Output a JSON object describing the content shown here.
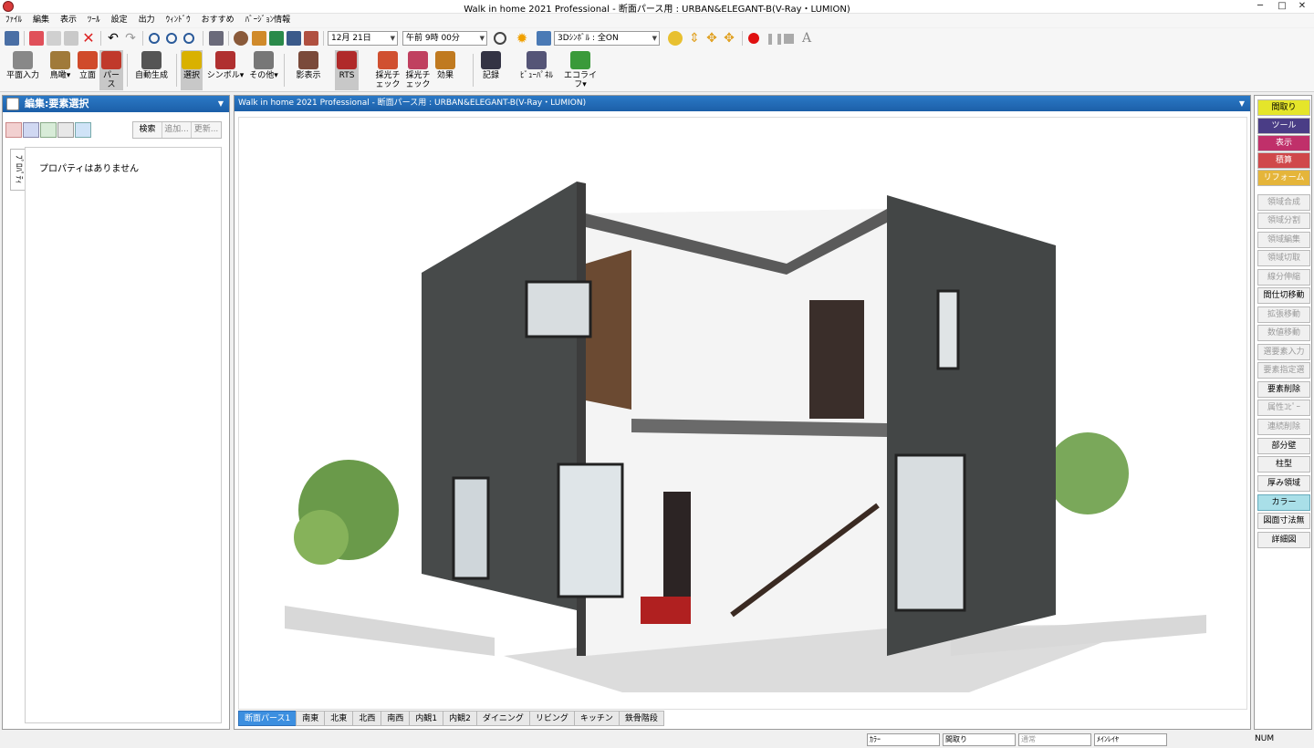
{
  "window": {
    "title": "Walk in home 2021 Professional - 断面パース用 : URBAN&ELEGANT-B(V-Ray・LUMION)",
    "minimize": "─",
    "maximize": "□",
    "close": "✕"
  },
  "menu": [
    "ﾌｧｲﾙ",
    "編集",
    "表示",
    "ﾂｰﾙ",
    "設定",
    "出力",
    "ｳｨﾝﾄﾞｳ",
    "おすすめ",
    "ﾊﾞｰｼﾞｮﾝ情報"
  ],
  "toolbar1": {
    "date": "12月 21日",
    "time": "午前 9時 00分",
    "symbol3d": "3Dｼﾝﾎﾞﾙ : 全ON"
  },
  "toolbar2": [
    {
      "label": "平面入力",
      "color": "#5a5a5a"
    },
    {
      "label": "鳥瞰▾",
      "color": "#9a6a2a"
    },
    {
      "label": "立面",
      "color": "#d04a2a"
    },
    {
      "label": "パース",
      "color": "#c0392b",
      "active": true
    },
    {
      "label": "自動生成",
      "color": "#555"
    },
    {
      "label": "選択",
      "color": "#d9b100",
      "active": true
    },
    {
      "label": "シンボル▾",
      "color": "#b03030"
    },
    {
      "label": "その他▾",
      "color": "#777"
    },
    {
      "label": "影表示",
      "color": "#7a4a3a"
    },
    {
      "label": "RTS",
      "color": "#b02a2a",
      "active": true
    },
    {
      "label": "採光チェック",
      "color": "#d05030"
    },
    {
      "label": "採光チェック",
      "color": "#c04060"
    },
    {
      "label": "効果",
      "color": "#c07a20"
    },
    {
      "label": "記録",
      "color": "#334"
    },
    {
      "label": "ﾋﾞｭｰﾊﾟﾈﾙ",
      "color": "#557"
    },
    {
      "label": "エコライフ▾",
      "color": "#3a9a3a"
    }
  ],
  "leftpanel": {
    "title": "編集:要素選択",
    "search": "検索",
    "add": "追加...",
    "update": "更新...",
    "side_tab": "ﾌﾟﾛﾊﾟﾃｨ",
    "empty": "プロパティはありません"
  },
  "view": {
    "title": "Walk in home 2021 Professional - 断面パース用 : URBAN&ELEGANT-B(V-Ray・LUMION)"
  },
  "tabs": [
    "断面パース1",
    "南東",
    "北東",
    "北西",
    "南西",
    "内観1",
    "内観2",
    "ダイニング",
    "リビング",
    "キッチン",
    "鉄骨階段"
  ],
  "rightpanel": {
    "top": [
      {
        "label": "間取り",
        "color": "#e5e52a",
        "text": "#000"
      },
      {
        "label": "ツール",
        "color": "#4a3d86",
        "text": "#fff"
      },
      {
        "label": "表示",
        "color": "#c0306a",
        "text": "#fff"
      },
      {
        "label": "積算",
        "color": "#d0484a",
        "text": "#fff"
      },
      {
        "label": "リフォーム",
        "color": "#e5b53a",
        "text": "#fff"
      }
    ],
    "items": [
      {
        "label": "領域合成",
        "disabled": true
      },
      {
        "label": "領域分割",
        "disabled": true
      },
      {
        "label": "領域編集",
        "disabled": true
      },
      {
        "label": "領域切取",
        "disabled": true
      },
      {
        "label": "線分伸縮",
        "disabled": true
      },
      {
        "label": "間仕切移動",
        "disabled": false
      },
      {
        "label": "拡張移動",
        "disabled": true
      },
      {
        "label": "数値移動",
        "disabled": true
      },
      {
        "label": "選要素入力",
        "disabled": true
      },
      {
        "label": "要素指定選",
        "disabled": true
      },
      {
        "label": "要素削除",
        "disabled": false
      },
      {
        "label": "属性ｺﾋﾟｰ",
        "disabled": true
      },
      {
        "label": "連続削除",
        "disabled": true
      },
      {
        "label": "部分壁",
        "disabled": false
      },
      {
        "label": "柱型",
        "disabled": false
      },
      {
        "label": "厚み領域",
        "disabled": false
      },
      {
        "label": "カラー",
        "disabled": false,
        "highlight": true
      },
      {
        "label": "図面寸法無",
        "disabled": false
      },
      {
        "label": "詳細図",
        "disabled": false
      }
    ]
  },
  "status": {
    "s1": "ｶﾗｰ",
    "s2": "間取り",
    "s3": "通常",
    "s4": "ﾒｲﾝﾚｲﾔ",
    "num": "NUM"
  }
}
